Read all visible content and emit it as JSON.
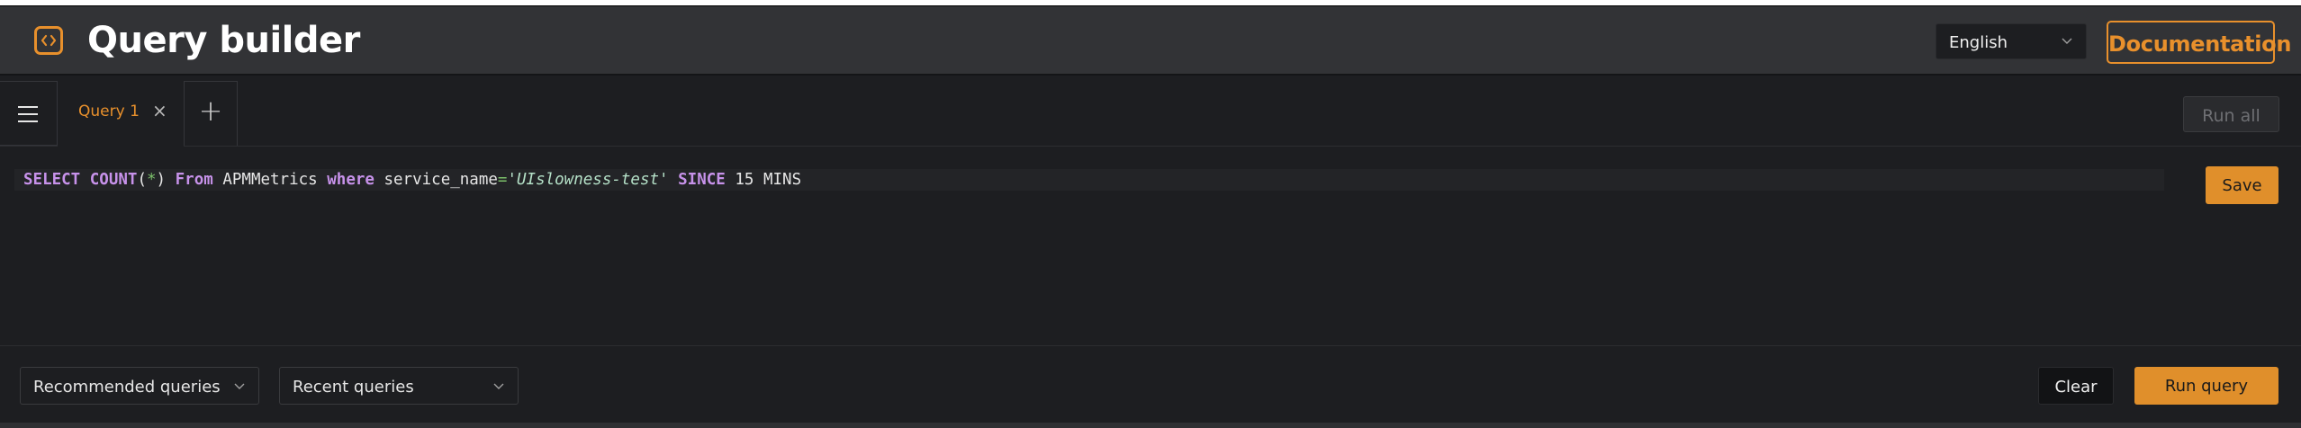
{
  "header": {
    "title": "Query builder",
    "language": "English",
    "documentation_label": "Documentation"
  },
  "tabs": {
    "items": [
      {
        "label": "Query 1",
        "active": true
      }
    ],
    "add_label": "+",
    "close_glyph": "×",
    "run_all_label": "Run all"
  },
  "editor": {
    "tokens": {
      "select": "SELECT",
      "count": "COUNT",
      "open": "(",
      "star": "*",
      "close": ")",
      "from": "From",
      "table": "APMMetrics",
      "where": "where",
      "field": "service_name",
      "eq": "=",
      "value": "'UIslowness-test'",
      "since": "SINCE",
      "duration": "15 MINS"
    },
    "save_label": "Save"
  },
  "footer": {
    "recommended_label": "Recommended queries",
    "recent_label": "Recent queries",
    "clear_label": "Clear",
    "run_label": "Run query"
  },
  "icons": {
    "logo": "code-brackets-icon",
    "menu": "hamburger-menu-icon",
    "chevron": "chevron-down-icon",
    "close": "close-icon"
  },
  "colors": {
    "accent": "#e8902c",
    "background": "#1d1e21",
    "header": "#323336",
    "keyword": "#c792ea",
    "string": "#b5e1c8"
  }
}
